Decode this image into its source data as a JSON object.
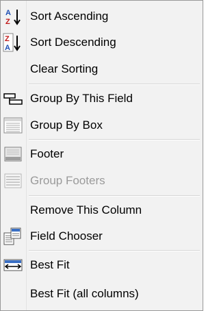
{
  "menu": {
    "items": [
      {
        "key": "sort_asc",
        "label": "Sort Ascending",
        "icon": "sort-ascending-icon",
        "enabled": true
      },
      {
        "key": "sort_desc",
        "label": "Sort Descending",
        "icon": "sort-descending-icon",
        "enabled": true
      },
      {
        "key": "clear_sort",
        "label": "Clear Sorting",
        "icon": "",
        "enabled": true
      },
      {
        "key": "group_field",
        "label": "Group By This Field",
        "icon": "group-by-field-icon",
        "enabled": true
      },
      {
        "key": "group_box",
        "label": "Group By Box",
        "icon": "group-by-box-icon",
        "enabled": true
      },
      {
        "key": "footer",
        "label": "Footer",
        "icon": "footer-icon",
        "enabled": true
      },
      {
        "key": "group_footers",
        "label": "Group Footers",
        "icon": "group-footers-icon",
        "enabled": false
      },
      {
        "key": "remove_col",
        "label": "Remove This Column",
        "icon": "",
        "enabled": true
      },
      {
        "key": "field_chooser",
        "label": "Field Chooser",
        "icon": "field-chooser-icon",
        "enabled": true
      },
      {
        "key": "best_fit",
        "label": "Best Fit",
        "icon": "best-fit-icon",
        "enabled": true
      },
      {
        "key": "best_fit_all",
        "label": "Best Fit (all columns)",
        "icon": "",
        "enabled": true
      }
    ],
    "colors": {
      "background": "#f2f2f2",
      "border": "#979797",
      "disabled_text": "#9a9a9a"
    }
  }
}
